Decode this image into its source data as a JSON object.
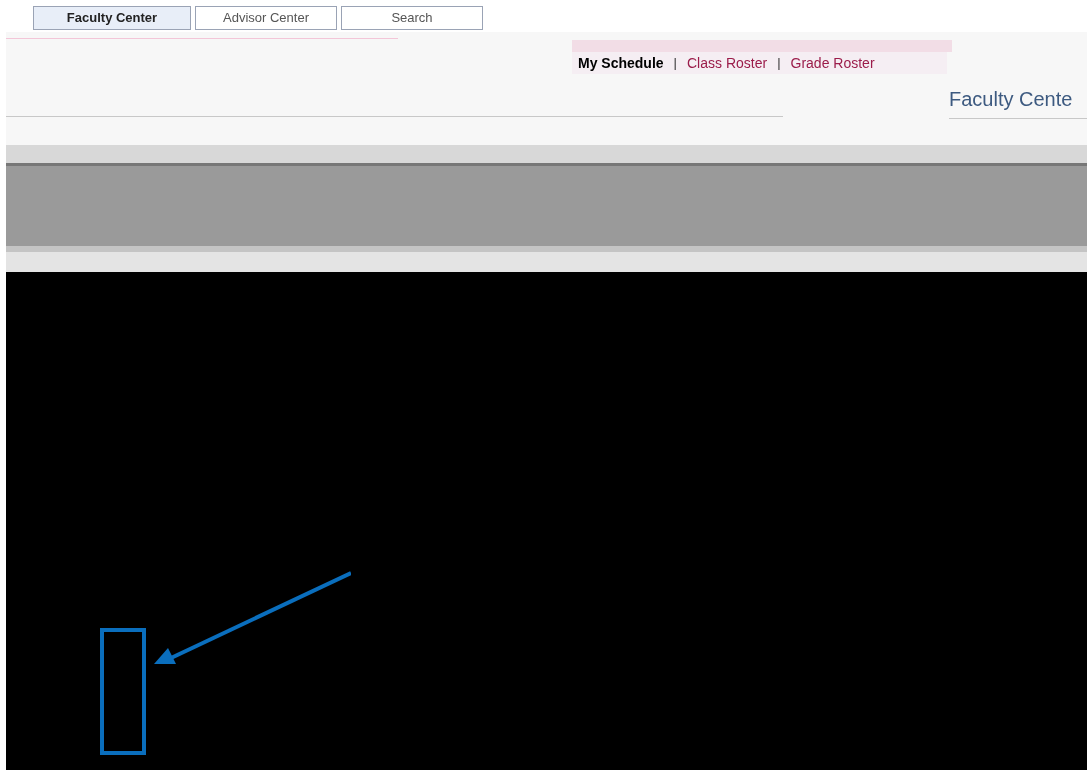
{
  "top_tabs": [
    {
      "label": "Faculty Center",
      "selected": true
    },
    {
      "label": "Advisor Center",
      "selected": false
    },
    {
      "label": "Search",
      "selected": false
    }
  ],
  "sub_nav": [
    {
      "kind": "link",
      "label": "My Schedule",
      "selected": true
    },
    {
      "kind": "divider",
      "label": "|"
    },
    {
      "kind": "link",
      "label": "Class Roster",
      "selected": false
    },
    {
      "kind": "divider",
      "label": "|"
    },
    {
      "kind": "link",
      "label": "Grade Roster",
      "selected": false
    }
  ],
  "page_title": "Faculty Cente"
}
